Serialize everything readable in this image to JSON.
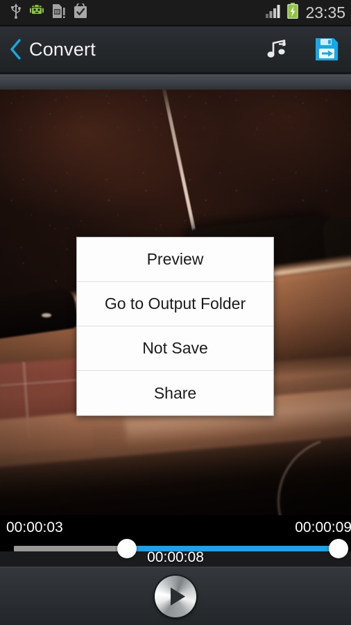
{
  "statusbar": {
    "icons_left": [
      {
        "name": "usb-icon",
        "label": "USB connected"
      },
      {
        "name": "android-robot-icon",
        "label": "Android debugging"
      },
      {
        "name": "sd-card-alert-icon",
        "label": "SD card"
      },
      {
        "name": "play-store-bag-check-icon",
        "label": "App installed"
      }
    ],
    "icons_right": [
      {
        "name": "signal-bars-icon",
        "label": "Signal"
      },
      {
        "name": "battery-charging-icon",
        "label": "Battery charging"
      }
    ],
    "clock": "23:35",
    "clock_color": "#cfcfcf"
  },
  "actionbar": {
    "back_label": "‹",
    "title": "Convert",
    "back_color": "#18a8e0",
    "actions": [
      {
        "name": "extract-audio-icon",
        "label": "Music note"
      },
      {
        "name": "save-icon",
        "label": "Save"
      }
    ],
    "save_color": "#18a8e0",
    "bar_bg": "#282c30"
  },
  "dialog": {
    "name": "convert-result-dialog",
    "items": [
      {
        "label": "Preview"
      },
      {
        "label": "Go to Output Folder"
      },
      {
        "label": "Not Save"
      },
      {
        "label": "Share"
      }
    ]
  },
  "player": {
    "start_time": "00:00:03",
    "end_time": "00:00:09",
    "duration": "00:00:08",
    "track_color": "#1ba2e8",
    "track_bg": "#9a9894",
    "play_button_name": "play-button"
  }
}
